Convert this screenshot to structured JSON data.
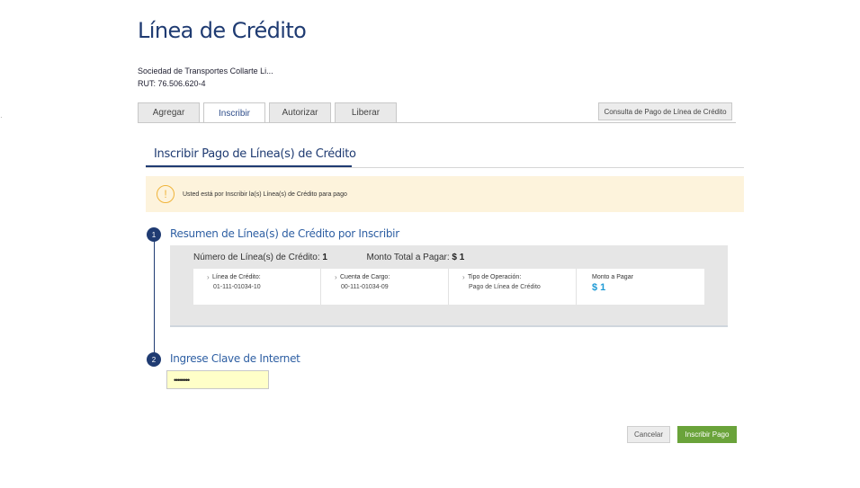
{
  "page": {
    "title": "Línea de Crédito",
    "company": "Sociedad de Transportes Collarte Li...",
    "rut": "RUT: 76.506.620-4"
  },
  "tabs": [
    {
      "label": "Agregar",
      "active": false
    },
    {
      "label": "Inscribir",
      "active": true
    },
    {
      "label": "Autorizar",
      "active": false
    },
    {
      "label": "Liberar",
      "active": false
    }
  ],
  "consult_button": "Consulta de Pago de Línea de Crédito",
  "section": {
    "title": "Inscribir Pago de Línea(s) de Crédito"
  },
  "alert": {
    "icon": "warning-icon",
    "icon_glyph": "!",
    "text": "Usted está por Inscribir la(s) Línea(s) de Crédito para pago"
  },
  "step1": {
    "number": "1",
    "title": "Resumen de Línea(s) de Crédito por Inscribir",
    "count_label": "Número de Línea(s) de Crédito:",
    "count_value": "1",
    "total_label": "Monto Total a Pagar:",
    "total_value": "$ 1",
    "cells": [
      {
        "label": "Línea de Crédito:",
        "value": "01-111-01034-10"
      },
      {
        "label": "Cuenta de Cargo:",
        "value": "00-111-01034-09"
      },
      {
        "label": "Tipo de Operación:",
        "value": "Pago de Línea de Crédito"
      }
    ],
    "amount": {
      "label": "Monto a Pagar",
      "value": "$ 1"
    }
  },
  "step2": {
    "number": "2",
    "title": "Ingrese Clave de Internet",
    "password_value": "••••••••"
  },
  "buttons": {
    "cancel": "Cancelar",
    "submit": "Inscribir Pago"
  },
  "colors": {
    "primary": "#1f3b72",
    "accent_link": "#2e5fa3",
    "amount": "#1e9ad6",
    "submit": "#6aa33a",
    "alert_bg": "#fdf3dc",
    "alert_icon": "#f0b43a",
    "input_bg": "#ffffc8"
  }
}
